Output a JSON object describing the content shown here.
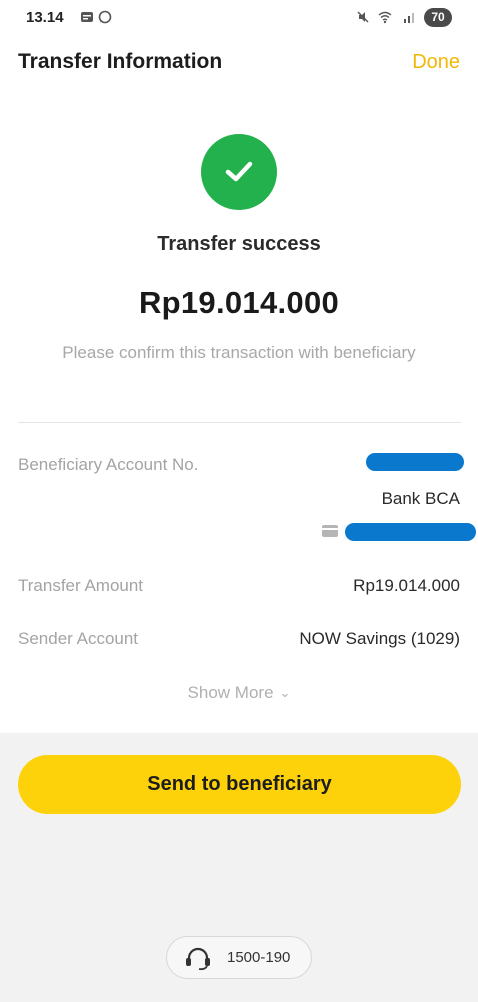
{
  "status_bar": {
    "time": "13.14",
    "battery": "70",
    "icons": [
      "photo-icon",
      "whatsapp-icon",
      "mute-icon",
      "wifi-icon",
      "signal-icon",
      "battery-icon"
    ]
  },
  "header": {
    "title": "Transfer Information",
    "done_label": "Done"
  },
  "result": {
    "title": "Transfer success",
    "amount": "Rp19.014.000",
    "note": "Please confirm this transaction with beneficiary"
  },
  "details": {
    "beneficiary_label": "Beneficiary Account No.",
    "bank_name": "Bank BCA",
    "transfer_amount_label": "Transfer Amount",
    "transfer_amount_value": "Rp19.014.000",
    "sender_label": "Sender Account",
    "sender_value": "NOW Savings (1029)",
    "show_more": "Show More"
  },
  "cta": {
    "label": "Send to beneficiary"
  },
  "helpline": {
    "number": "1500-190"
  },
  "colors": {
    "accent_yellow": "#fdd20b",
    "done_yellow": "#f2b705",
    "success_green": "#22b14c",
    "redaction_blue": "#0a78cc"
  }
}
